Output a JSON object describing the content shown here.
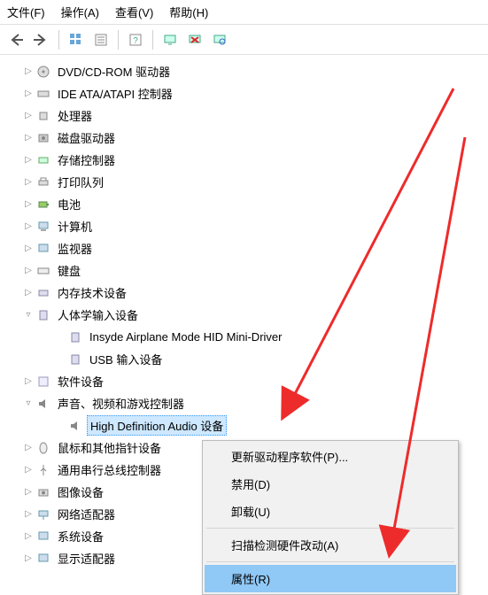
{
  "menu": {
    "file": "文件(F)",
    "action": "操作(A)",
    "view": "查看(V)",
    "help": "帮助(H)"
  },
  "tree": {
    "dvd": "DVD/CD-ROM 驱动器",
    "ide": "IDE ATA/ATAPI 控制器",
    "cpu": "处理器",
    "disk": "磁盘驱动器",
    "storage": "存储控制器",
    "print": "打印队列",
    "battery": "电池",
    "computer": "计算机",
    "monitor": "监视器",
    "keyboard": "键盘",
    "memory": "内存技术设备",
    "hid": "人体学输入设备",
    "hid_airplane": "Insyde Airplane Mode HID Mini-Driver",
    "hid_usb": "USB 输入设备",
    "software": "软件设备",
    "sound": "声音、视频和游戏控制器",
    "sound_hd": "High Definition Audio 设备",
    "mouse": "鼠标和其他指针设备",
    "usb": "通用串行总线控制器",
    "imaging": "图像设备",
    "network": "网络适配器",
    "system": "系统设备",
    "display": "显示适配器"
  },
  "context": {
    "update": "更新驱动程序软件(P)...",
    "disable": "禁用(D)",
    "uninstall": "卸载(U)",
    "scan": "扫描检测硬件改动(A)",
    "properties": "属性(R)"
  }
}
